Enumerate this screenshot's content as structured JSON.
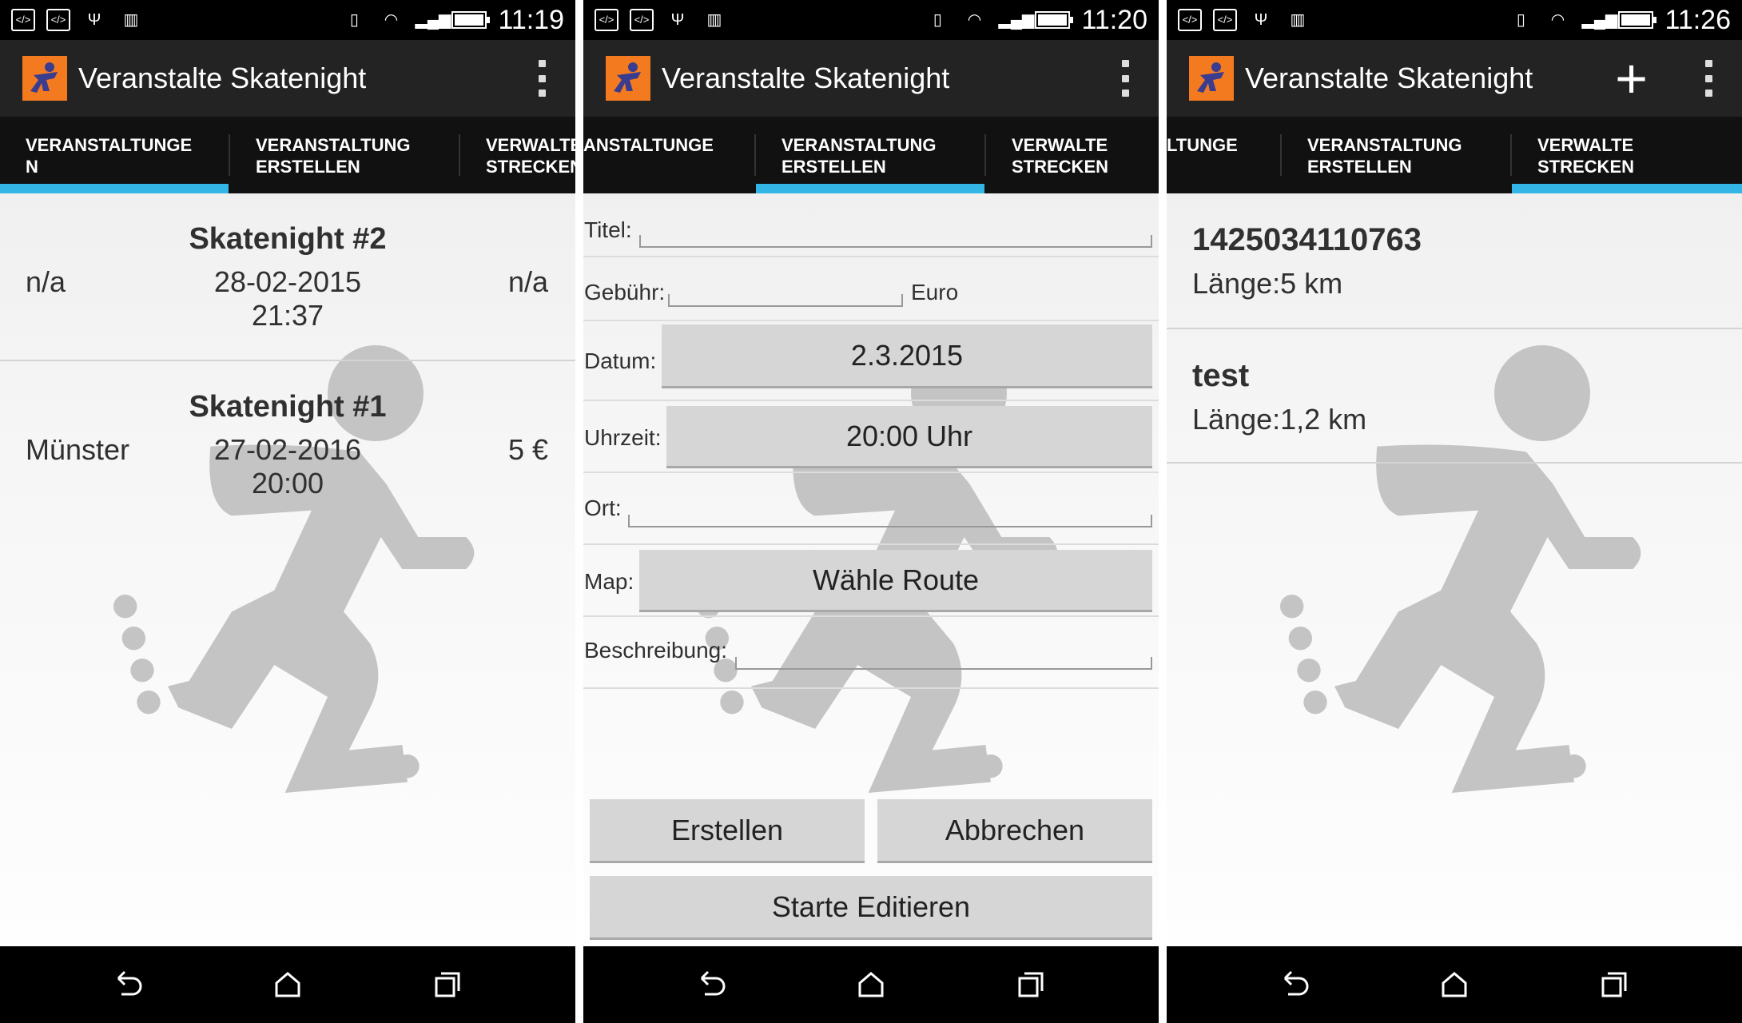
{
  "screens": [
    {
      "status": {
        "time": "11:19"
      },
      "app_title": "Veranstalte Skatenight",
      "tabs": [
        "VERANSTALTUNGE\nN",
        "VERANSTALTUNG\nERSTELLEN",
        "VERWALTE\nSTRECKEN"
      ],
      "active_tab": 0,
      "events": [
        {
          "title": "Skatenight #2",
          "location": "n/a",
          "date": "28-02-2015",
          "time": "21:37",
          "fee": "n/a"
        },
        {
          "title": "Skatenight #1",
          "location": "Münster",
          "date": "27-02-2016",
          "time": "20:00",
          "fee": "5 €"
        }
      ]
    },
    {
      "status": {
        "time": "11:20"
      },
      "app_title": "Veranstalte Skatenight",
      "tabs": [
        "ANSTALTUNGE",
        "VERANSTALTUNG\nERSTELLEN",
        "VERWALTE\nSTRECKEN"
      ],
      "active_tab": 1,
      "form": {
        "title_label": "Titel:",
        "title_value": "",
        "fee_label": "Gebühr:",
        "fee_value": "",
        "fee_unit": "Euro",
        "date_label": "Datum:",
        "date_value": "2.3.2015",
        "time_label": "Uhrzeit:",
        "time_value": "20:00 Uhr",
        "place_label": "Ort:",
        "place_value": "",
        "map_label": "Map:",
        "map_button": "Wähle Route",
        "desc_label": "Beschreibung:",
        "desc_value": "",
        "create_button": "Erstellen",
        "cancel_button": "Abbrechen",
        "edit_button": "Starte Editieren"
      }
    },
    {
      "status": {
        "time": "11:26"
      },
      "app_title": "Veranstalte Skatenight",
      "tabs": [
        "LTUNGE",
        "VERANSTALTUNG\nERSTELLEN",
        "VERWALTE\nSTRECKEN"
      ],
      "active_tab": 2,
      "routes": [
        {
          "name": "1425034110763",
          "length": "Länge:5 km"
        },
        {
          "name": "test",
          "length": "Länge:1,2 km"
        }
      ]
    }
  ],
  "colors": {
    "accent": "#33b5e5",
    "action_bar": "#232323",
    "tab_bar": "#111111",
    "logo": "#f47a20",
    "button": "#d6d6d6"
  },
  "icons": [
    "debug-icon",
    "usb-icon",
    "barcode-icon",
    "vibrate-icon",
    "wifi-icon",
    "signal-icon",
    "battery-icon",
    "overflow-menu-icon",
    "add-icon",
    "back-icon",
    "home-icon",
    "recents-icon"
  ]
}
